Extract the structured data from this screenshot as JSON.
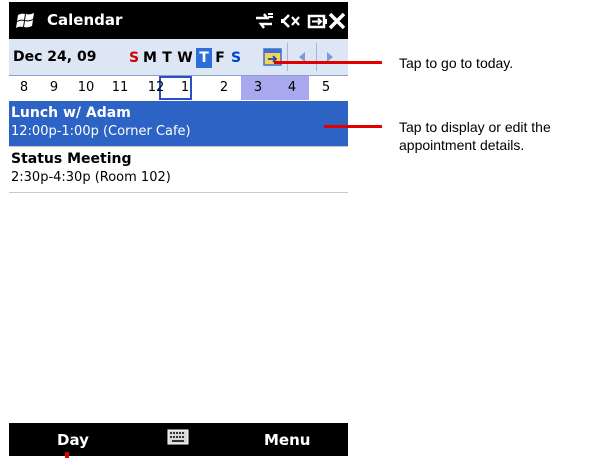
{
  "app": {
    "title": "Calendar"
  },
  "status_icons": [
    "connectivity-icon",
    "volume-muted-icon",
    "battery-icon",
    "close-icon"
  ],
  "datebar": {
    "date_label": "Dec 24, 09",
    "weekdays": [
      "S",
      "M",
      "T",
      "W",
      "T",
      "F",
      "S"
    ],
    "selected_weekday_index": 4,
    "today_button": "go-to-today-icon",
    "nav": [
      "arrow-left-icon",
      "arrow-right-icon"
    ]
  },
  "numbers": [
    "8",
    "9",
    "10",
    "11",
    "12",
    "1",
    "2",
    "3",
    "4",
    "5"
  ],
  "appointments": [
    {
      "title": "Lunch w/ Adam",
      "detail": "12:00p-1:00p (Corner Cafe)"
    },
    {
      "title": "Status Meeting",
      "detail": "2:30p-4:30p (Room 102)"
    }
  ],
  "softkeys": {
    "left": "Day",
    "right": "Menu"
  },
  "callouts": {
    "today": "Tap to go to today.",
    "details_line1": "Tap to display or edit the",
    "details_line2": "appointment details."
  },
  "colors": {
    "selection": "#2d63c4",
    "highlight_hours": "#a7a8ee",
    "callout": "#e00000"
  }
}
